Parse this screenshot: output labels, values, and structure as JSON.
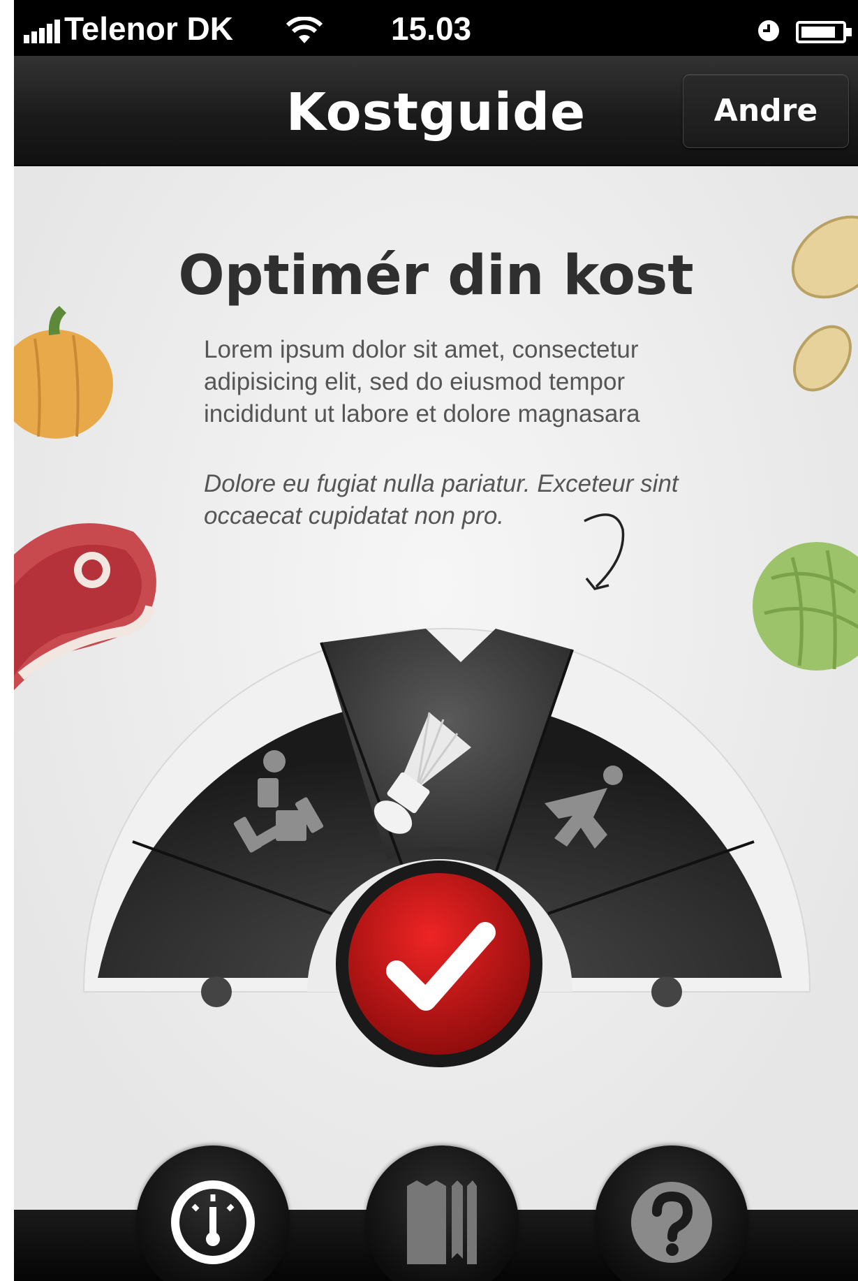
{
  "status_bar": {
    "carrier": "Telenor DK",
    "time": "15.03",
    "icons": [
      "signal-icon",
      "wifi-icon",
      "clock-icon",
      "battery-icon"
    ]
  },
  "nav": {
    "title": "Kostguide",
    "right_button": "Andre"
  },
  "main": {
    "headline": "Optimér din kost",
    "body": "Lorem ipsum dolor sit amet, consectetur adipisicing elit, sed do eiusmod tempor incididunt ut labore et dolore magnasara",
    "italic": "Dolore eu fugiat nulla pariatur. Exceteur sint occaecat cupidatat non pro."
  },
  "activity_selector": {
    "options": [
      "weightlifting-icon",
      "badminton-icon",
      "running-icon"
    ],
    "selected": "badminton-icon",
    "confirm": "checkmark-icon"
  },
  "tab_bar": {
    "tabs": [
      "gauge-icon",
      "receipt-icon",
      "help-icon"
    ],
    "selected": "gauge-icon"
  },
  "colors": {
    "accent_red": "#c8161b",
    "nav_dark": "#1b1b1b",
    "background": "#ebebeb"
  }
}
